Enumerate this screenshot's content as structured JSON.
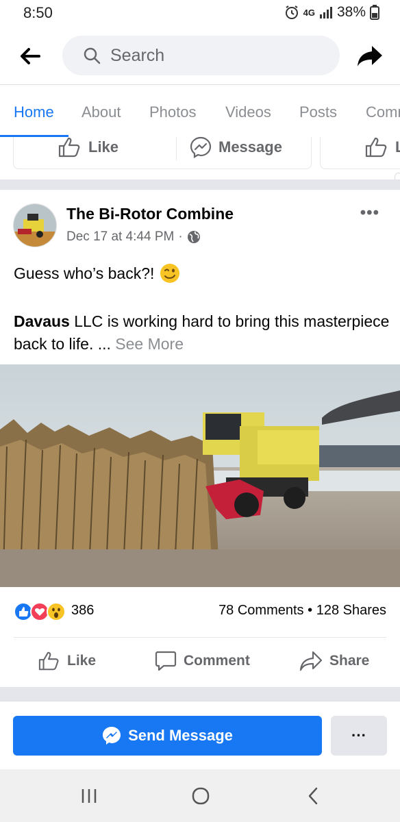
{
  "status_bar": {
    "time": "8:50",
    "network": "4G",
    "battery": "38%"
  },
  "header": {
    "search_placeholder": "Search",
    "back_icon": "arrow-left-icon",
    "share_icon": "share-arrow-icon"
  },
  "tabs": [
    "Home",
    "About",
    "Photos",
    "Videos",
    "Posts",
    "Comm"
  ],
  "active_tab": "Home",
  "page_actions": {
    "like_label": "Like",
    "message_label": "Message",
    "partial_label": "L"
  },
  "post": {
    "author": "The Bi-Rotor Combine",
    "timestamp": "Dec 17 at 4:44 PM",
    "separator": "·",
    "privacy_icon": "globe-icon",
    "text_line1": "Guess who’s back?!",
    "emoji": "winking-face-icon",
    "mention": "Davaus",
    "text_body": " LLC is working hard to bring this masterpiece back to life. ... ",
    "see_more": "See More",
    "reaction_count": "386",
    "comments": "78 Comments",
    "counts_separator": "•",
    "shares": "128 Shares",
    "actions": {
      "like": "Like",
      "comment": "Comment",
      "share": "Share"
    }
  },
  "bottom": {
    "send_message": "Send Message",
    "more": "···"
  },
  "colors": {
    "accent": "#1877f2",
    "secondary_text": "#65676b",
    "divider": "#e4e6eb"
  }
}
